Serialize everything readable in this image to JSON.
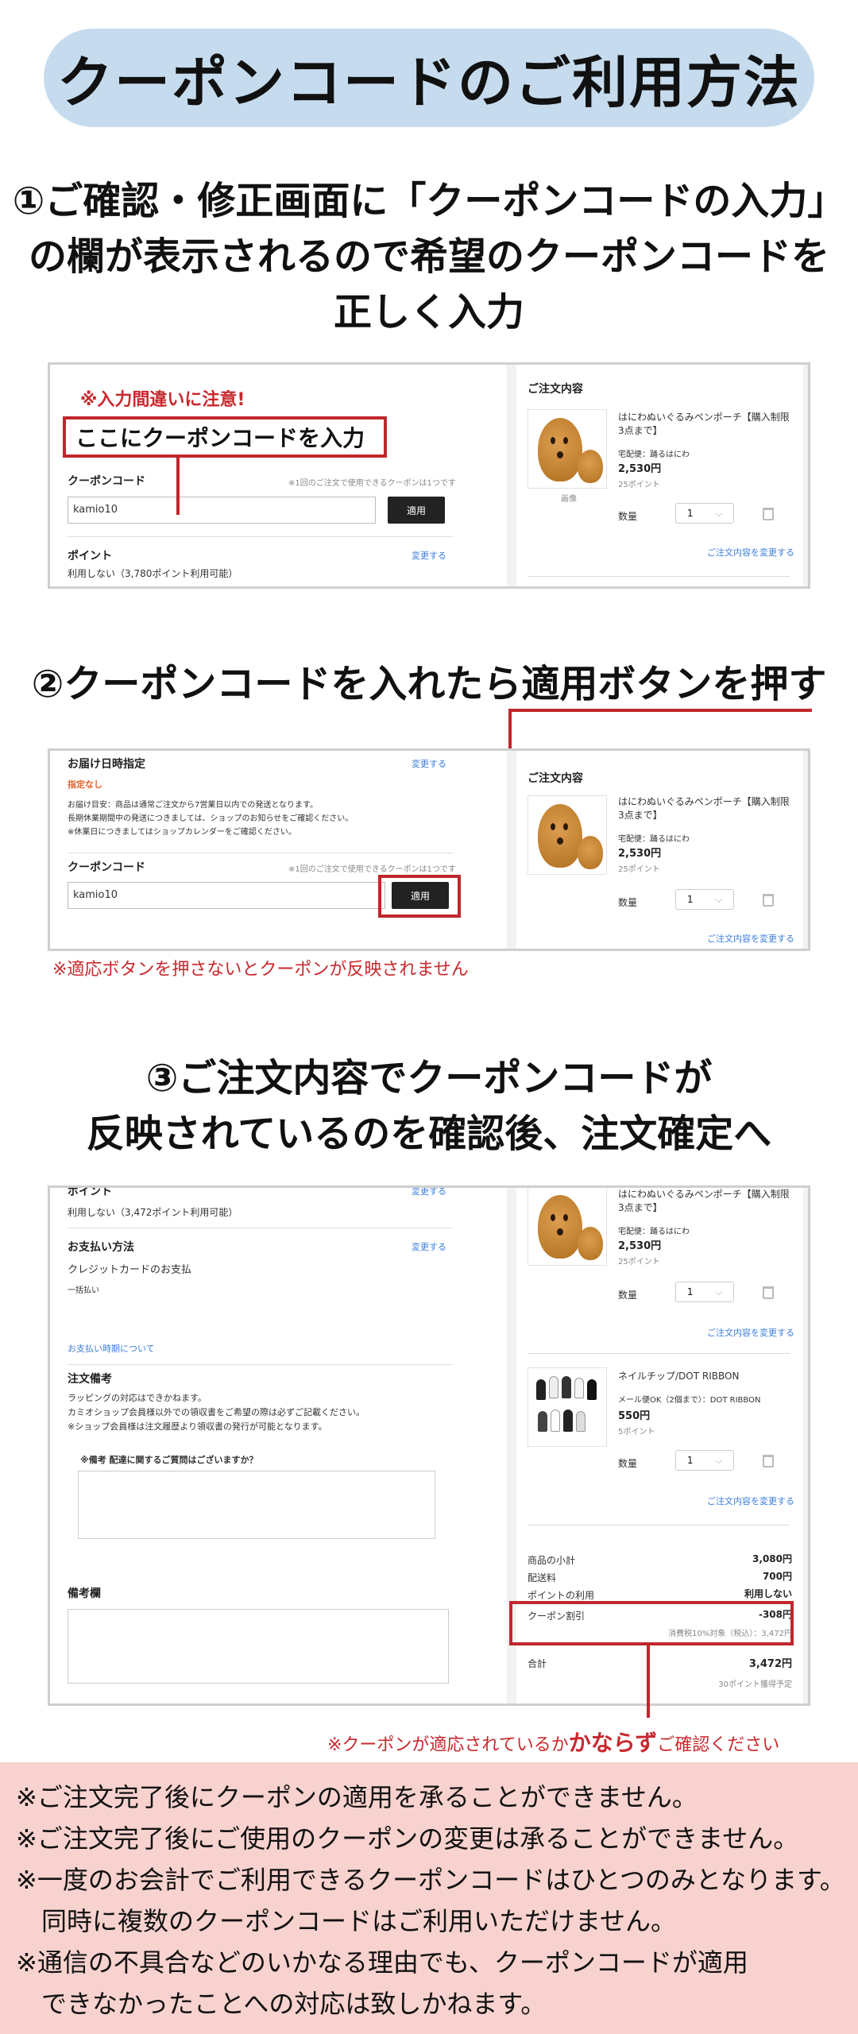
{
  "title": "クーポンコードのご利用方法",
  "step1": {
    "heading_lines": [
      "①ご確認・修正画面に「クーポンコードの入力」",
      "の欄が表示されるので希望のクーポンコードを",
      "正しく入力"
    ],
    "warning": "※入力間違いに注意!",
    "callout": "ここにクーポンコードを入力",
    "coupon_label": "クーポンコード",
    "coupon_hint": "※1回のご注文で使用できるクーポンは1つです",
    "coupon_value": "kamio10",
    "apply_button": "適用",
    "points_label": "ポイント",
    "points_change": "変更する",
    "points_value": "利用しない（3,780ポイント利用可能）"
  },
  "order": {
    "section_title": "ご注文内容",
    "item1": {
      "name": "はにわぬいぐるみペンポーチ【購入制限3点まで】",
      "delivery": "宅配便：踊るはにわ",
      "price": "2,530円",
      "points": "25ポイント",
      "qty_label": "数量",
      "qty": "1"
    },
    "item2": {
      "name": "ネイルチップ/DOT RIBBON",
      "delivery": "メール便OK（2個まで）：DOT RIBBON",
      "price": "550円",
      "points": "5ポイント",
      "qty_label": "数量",
      "qty": "1"
    },
    "edit_link": "ご注文内容を変更する",
    "mini_caption": "画像"
  },
  "step2": {
    "heading": "②クーポンコードを入れたら適用ボタンを押す",
    "delivery_title": "お届け日時指定",
    "delivery_change": "変更する",
    "delivery_none": "指定なし",
    "delivery_notes": [
      "お届け目安：商品は通常ご注文から7営業日以内での発送となります。",
      "長期休業期間中の発送につきましては、ショップのお知らせをご確認ください。",
      "※休業日につきましてはショップカレンダーをご確認ください。"
    ],
    "coupon_label": "クーポンコード",
    "coupon_hint": "※1回のご注文で使用できるクーポンは1つです",
    "coupon_value": "kamio10",
    "apply_button": "適用",
    "warning": "※適応ボタンを押さないとクーポンが反映されません"
  },
  "step3": {
    "heading_lines": [
      "③ご注文内容でクーポンコードが",
      "反映されているのを確認後、注文確定へ"
    ],
    "points_label": "ポイント",
    "points_change": "変更する",
    "points_value": "利用しない（3,472ポイント利用可能）",
    "payment_title": "お支払い方法",
    "payment_change": "変更する",
    "payment_method": "クレジットカードのお支払",
    "payment_type": "一括払い",
    "payment_link": "お支払い時期について",
    "note_title": "注文備考",
    "note_lines": [
      "ラッピングの対応はできかねます。",
      "カミオショップ会員様以外での領収書をご希望の際は必ずご記載ください。",
      "※ショップ会員様は注文履歴より領収書の発行が可能となります。"
    ],
    "question": "※備考 配達に関するご質問はございますか？",
    "remarks_title": "備考欄",
    "summary": {
      "subtotal_label": "商品の小計",
      "subtotal": "3,080円",
      "shipping_label": "配送料",
      "shipping": "700円",
      "points_label": "ポイントの利用",
      "points": "利用しない",
      "coupon_label": "クーポン割引",
      "coupon": "-308円",
      "tax_note": "消費税10%対象（税込）：3,472円",
      "total_label": "合計",
      "total": "3,472円",
      "earn_note": "30ポイント獲得予定"
    },
    "warning_pre": "※クーポンが適応されているか",
    "warning_strong": "かならず",
    "warning_post": "ご確認ください"
  },
  "notes": [
    "※ご注文完了後にクーポンの適用を承ることができません。",
    "※ご注文完了後にご使用のクーポンの変更は承ることができません。",
    "※一度のお会計でご利用できるクーポンコードはひとつのみとなります。",
    "　同時に複数のクーポンコードはご利用いただけません。",
    "※通信の不具合などのいかなる理由でも、クーポンコードが適用",
    "　できなかったことへの対応は致しかねます。"
  ],
  "colors": {
    "accent_red": "#c0272d",
    "title_bg": "#c6dcee",
    "notes_bg": "#f8d2ce"
  }
}
